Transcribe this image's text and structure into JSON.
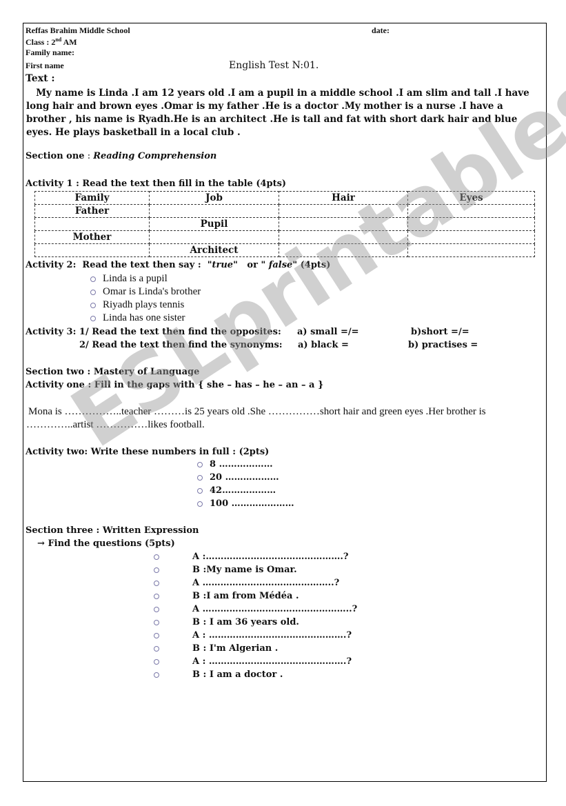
{
  "header": {
    "school": "Reffas Brahim Middle School",
    "date_label": "date:",
    "class_label": "Class : 2",
    "class_sup": "nd",
    "class_suffix": " AM",
    "family_name_label": "Family name:",
    "first_name_label": "First name",
    "test_title": "English Test N:01."
  },
  "text_section": {
    "label": "Text :",
    "paragraph": "   My name is Linda .I am 12 years old .I am a pupil in a middle school .I am slim and tall .I have long hair and brown eyes .Omar is my father .He is a doctor .My mother is a nurse .I have a brother , his name is Ryadh.He is an architect .He is tall and fat with short dark hair and blue eyes. He plays basketball in a local club ."
  },
  "section_one": {
    "label": "Section one",
    "sep": " : ",
    "title": "Reading Comprehension",
    "activity1": {
      "instruction": "Activity 1 : Read the text then fill in the table (4pts)",
      "headers": [
        "Family",
        "Job",
        "Hair",
        "Eyes"
      ],
      "rows": [
        [
          "Father",
          "",
          "",
          ""
        ],
        [
          "",
          "Pupil",
          "",
          ""
        ],
        [
          "Mother",
          "",
          "",
          ""
        ],
        [
          "",
          "Architect",
          "",
          ""
        ]
      ]
    },
    "activity2": {
      "prefix": "Activity 2:  Read the text then say :  \"",
      "true_word": "true",
      "mid": "\"   or \" ",
      "false_word": "false",
      "suffix": "\" (4pts)",
      "items": [
        "Linda is a pupil",
        "Omar is Linda's brother",
        "Riyadh plays tennis",
        "Linda has one sister"
      ]
    },
    "activity3": {
      "line1": "Activity 3: 1/ Read the text then find the opposites:",
      "line1_a": "a) small =/=",
      "line1_b": "b)short =/=",
      "line2": "2/ Read the text then find the synonyms:",
      "line2_a": "a) black =",
      "line2_b": "b) practises ="
    }
  },
  "section_two": {
    "label": "Section two : Mastery of Language",
    "activity_one": "Activity one : Fill in the gaps  with { she – has – he – an – a }",
    "gap_line1": "Mona is ……………..teacher ………is 25 years old .She ……………short hair and green eyes .Her brother is",
    "gap_line2": "…………..artist ……………likes football.",
    "activity_two": "Activity two: Write these numbers in full :  (2pts)",
    "numbers": [
      "8 ………………",
      "20 ………………",
      "42………………",
      "100  …………………"
    ]
  },
  "section_three": {
    "label": "Section three : Written Expression",
    "arrow": "→",
    "subtitle": "Find the questions  (5pts)",
    "dialogue": [
      "A :……………………………………….?",
      "B :My name is Omar.",
      "A ……………………………………..?",
      "B :I am from Médéa .",
      "A …………………………………………..?",
      "B : I am 36 years old.",
      "A : ……………………………………….?",
      "B : I'm Algerian .",
      "A : ……………………………………….?",
      "B : I am a doctor ."
    ]
  },
  "watermark": "ESLprintables.com"
}
